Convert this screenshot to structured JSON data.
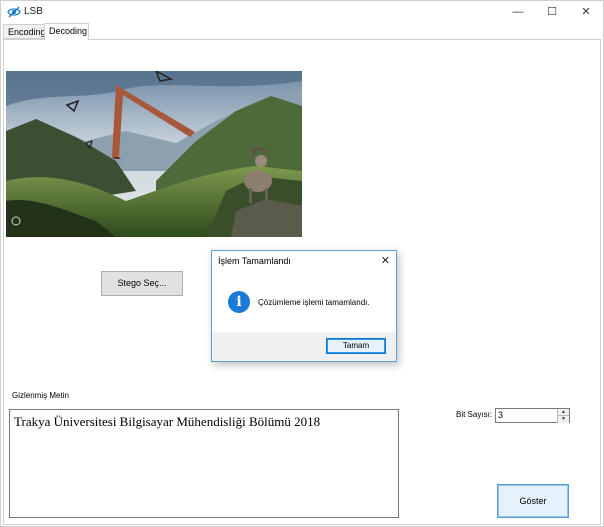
{
  "window": {
    "title": "LSB",
    "minimize_glyph": "—",
    "maximize_glyph": "☐",
    "close_glyph": "✕"
  },
  "tabs": [
    {
      "label": "Encoding",
      "active": false
    },
    {
      "label": "Decoding",
      "active": true
    }
  ],
  "decoding": {
    "stego_button": "Stego Seç...",
    "hidden_text_label": "Gizlenmiş Metin",
    "hidden_text_value": "Trakya Üniversitesi Bilgisayar Mühendisliği Bölümü 2018",
    "bit_count_label": "Bit Sayısı:",
    "bit_count_value": "3",
    "show_button": "Göster"
  },
  "dialog": {
    "title": "İşlem Tamamlandı",
    "message": "Çözümleme işlemi tamamlandı.",
    "ok_button": "Tamam",
    "close_glyph": "✕",
    "icon_glyph": "i"
  }
}
